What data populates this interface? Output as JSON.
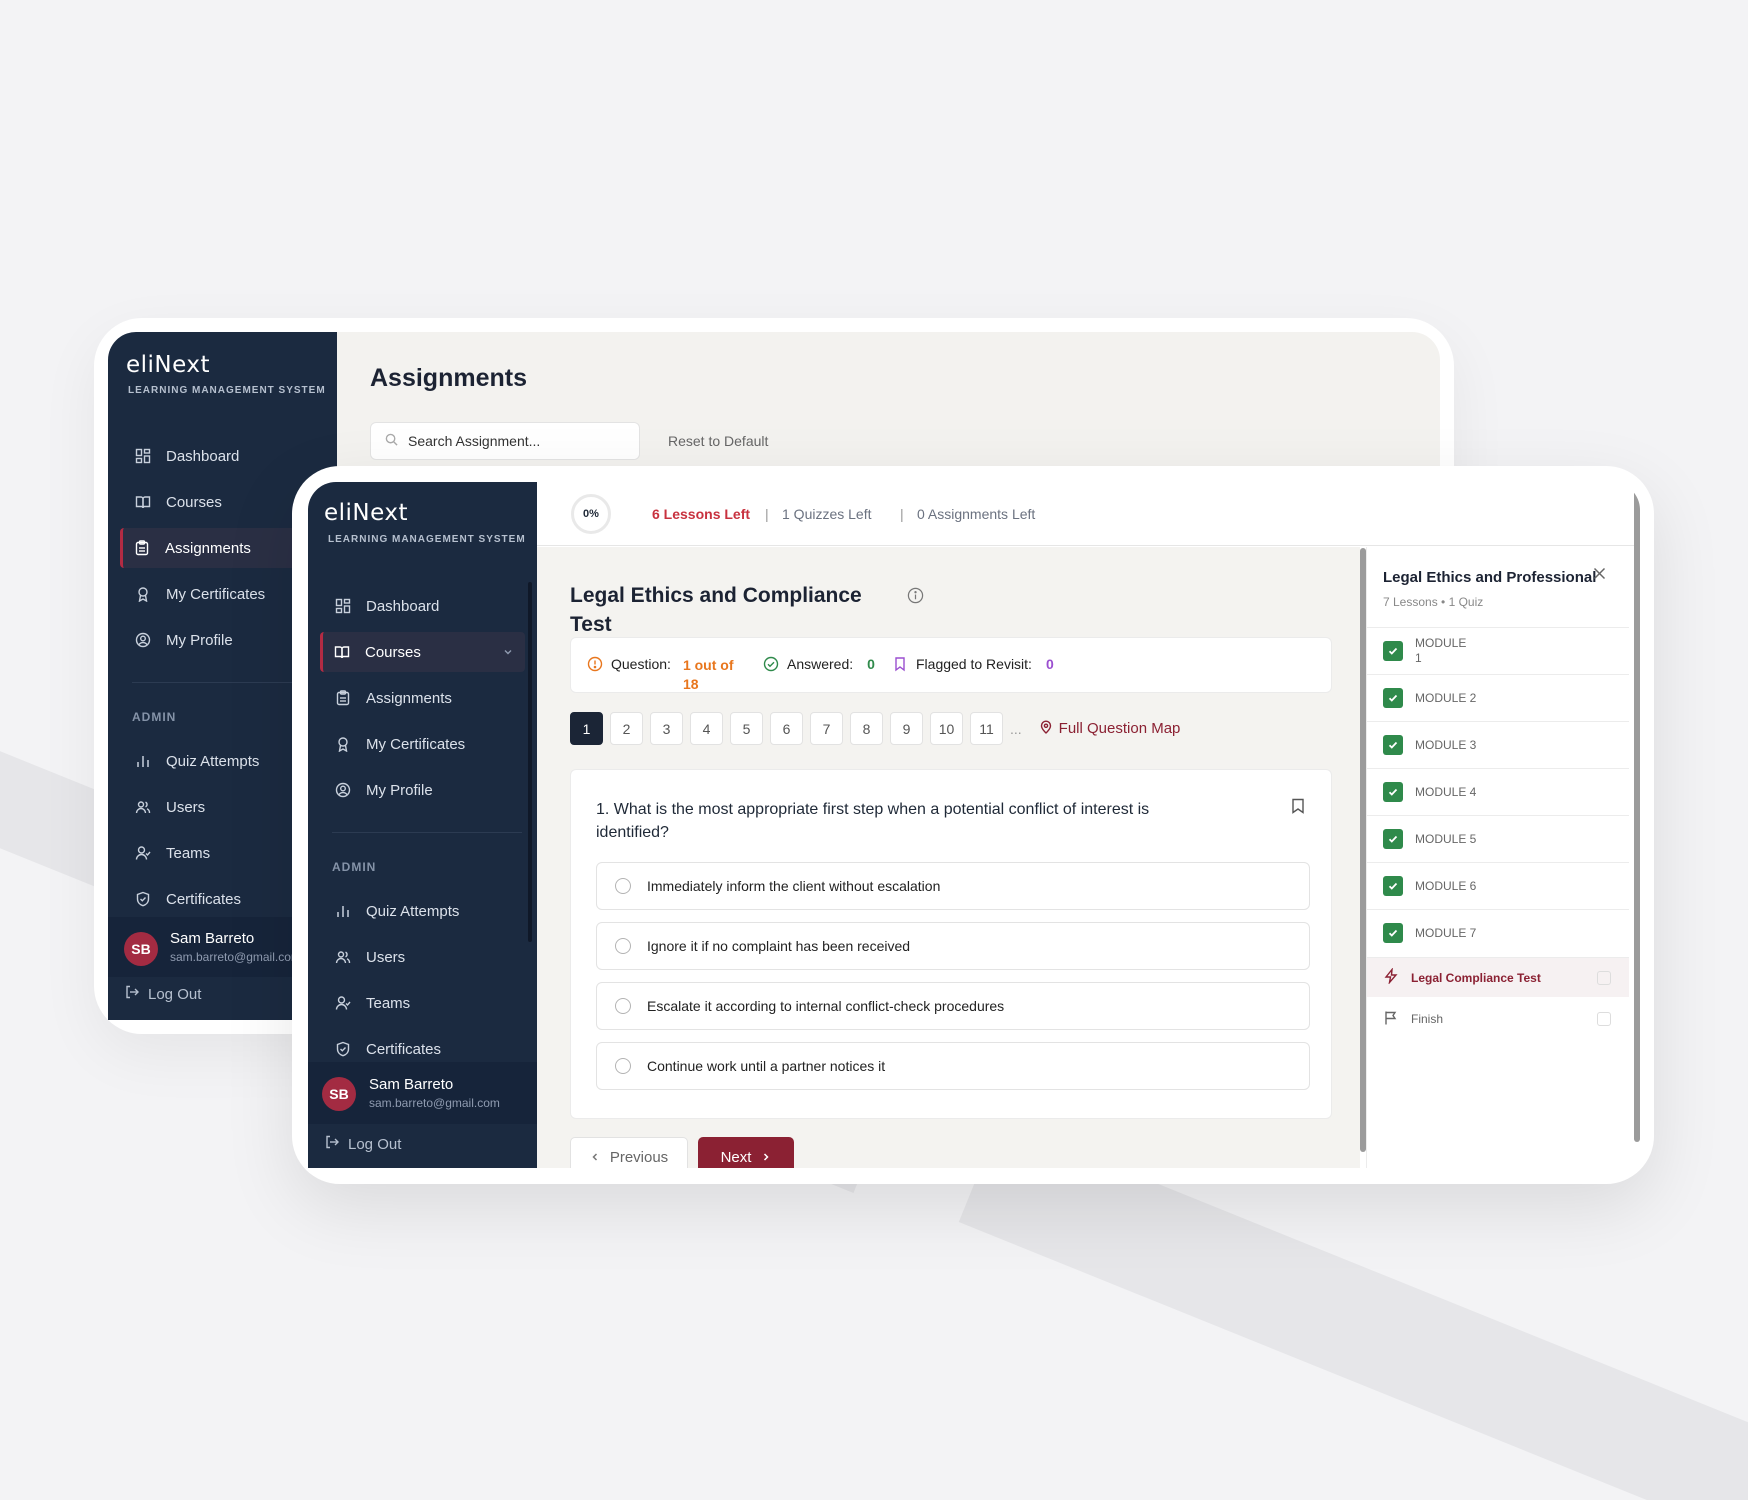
{
  "brand": {
    "logo": "eliNext",
    "subtitle": "LEARNING MANAGEMENT SYSTEM"
  },
  "back_window": {
    "page_title": "Assignments",
    "search_placeholder": "Search Assignment...",
    "reset_label": "Reset to Default",
    "nav": [
      {
        "label": "Dashboard",
        "icon": "dashboard-icon"
      },
      {
        "label": "Courses",
        "icon": "book-icon"
      },
      {
        "label": "Assignments",
        "icon": "clipboard-icon",
        "active": true
      },
      {
        "label": "My Certificates",
        "icon": "award-icon"
      },
      {
        "label": "My Profile",
        "icon": "user-circle-icon"
      }
    ],
    "admin_label": "ADMIN",
    "admin_nav": [
      {
        "label": "Quiz Attempts",
        "icon": "bar-chart-icon"
      },
      {
        "label": "Users",
        "icon": "users-icon"
      },
      {
        "label": "Teams",
        "icon": "team-icon"
      },
      {
        "label": "Certificates",
        "icon": "shield-icon"
      }
    ],
    "user": {
      "initials": "SB",
      "name": "Sam Barreto",
      "email": "sam.barreto@gmail.com"
    },
    "logout": "Log Out"
  },
  "front_window": {
    "nav": [
      {
        "label": "Dashboard",
        "icon": "dashboard-icon"
      },
      {
        "label": "Courses",
        "icon": "book-icon",
        "active": true
      },
      {
        "label": "Assignments",
        "icon": "clipboard-icon"
      },
      {
        "label": "My Certificates",
        "icon": "award-icon"
      },
      {
        "label": "My Profile",
        "icon": "user-circle-icon"
      }
    ],
    "admin_label": "ADMIN",
    "admin_nav": [
      {
        "label": "Quiz Attempts",
        "icon": "bar-chart-icon"
      },
      {
        "label": "Users",
        "icon": "users-icon"
      },
      {
        "label": "Teams",
        "icon": "team-icon"
      },
      {
        "label": "Certificates",
        "icon": "shield-icon"
      }
    ],
    "user": {
      "initials": "SB",
      "name": "Sam Barreto",
      "email": "sam.barreto@gmail.com"
    },
    "logout": "Log Out",
    "topbar": {
      "progress": "0%",
      "lessons_left": "6 Lessons Left",
      "sep": "|",
      "quizzes_left": "1 Quizzes Left",
      "assignments_left": "0 Assignments Left"
    },
    "quiz": {
      "title": "Legal Ethics and Compliance Test",
      "question_label": "Question:",
      "question_value": "1 out of 18",
      "answered_label": "Answered:",
      "answered_value": "0",
      "flagged_label": "Flagged to Revisit:",
      "flagged_value": "0",
      "pages": [
        "1",
        "2",
        "3",
        "4",
        "5",
        "6",
        "7",
        "8",
        "9",
        "10",
        "11"
      ],
      "current_page": "1",
      "ellipsis": "...",
      "question_map": "Full Question Map",
      "question_text": "1. What is the most appropriate first step when a potential conflict of interest is identified?",
      "options": [
        "Immediately inform the client without escalation",
        "Ignore it if no complaint has been received",
        "Escalate it according to internal conflict-check procedures",
        "Continue work until a partner notices it"
      ],
      "prev_label": "Previous",
      "next_label": "Next"
    },
    "course_panel": {
      "title": "Legal Ethics and Professional",
      "subtitle": "7 Lessons • 1 Quiz",
      "modules": [
        "MODULE 1",
        "MODULE 2",
        "MODULE 3",
        "MODULE 4",
        "MODULE 5",
        "MODULE 6",
        "MODULE 7"
      ],
      "test_label": "Legal Compliance Test",
      "finish_label": "Finish"
    }
  },
  "colors": {
    "sidebar": "#1b2a40",
    "accent": "#8b2133",
    "lessons_red": "#c8323f",
    "question_orange": "#e8761d",
    "answered_green": "#2f8a4b",
    "flagged_purple": "#9b4fd0",
    "check_green": "#2f8a4b"
  }
}
